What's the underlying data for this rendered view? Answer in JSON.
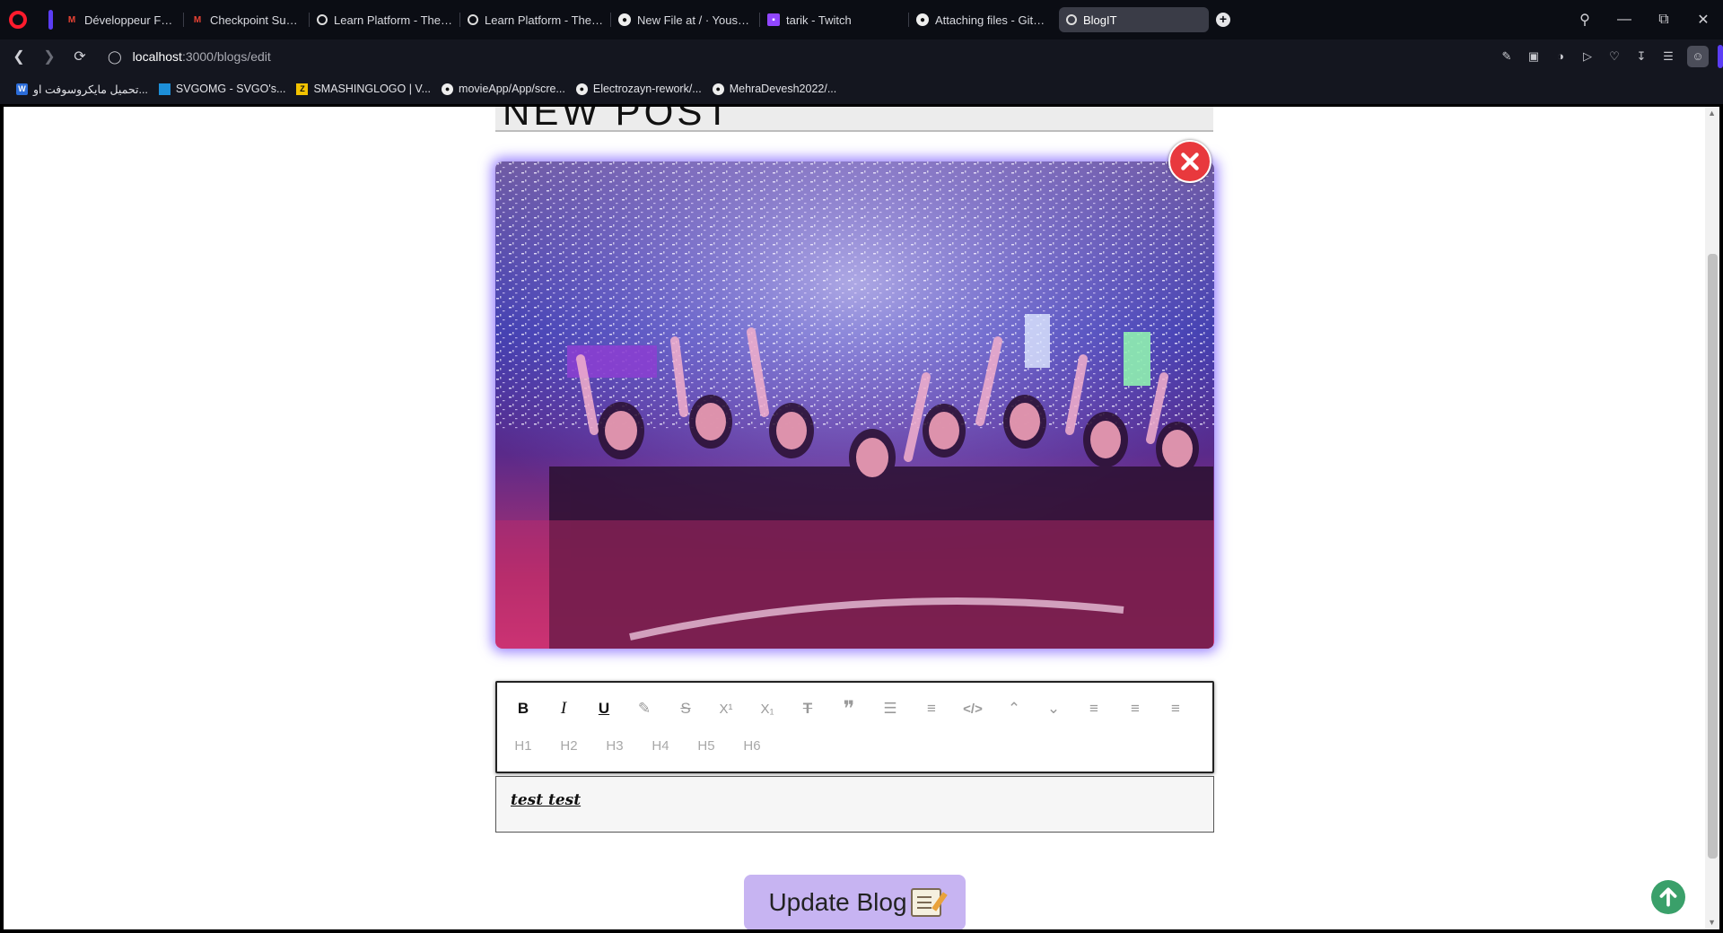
{
  "browser": {
    "tabs": [
      {
        "label": "Développeur Fullstack js -",
        "icon": "gmail-icon"
      },
      {
        "label": "Checkpoint Submitted - G",
        "icon": "gmail-icon"
      },
      {
        "label": "Learn Platform - The GOM",
        "icon": "globe-icon"
      },
      {
        "label": "Learn Platform - The GOM",
        "icon": "globe-icon"
      },
      {
        "label": "New File at / · YoussefRs/",
        "icon": "github-icon"
      },
      {
        "label": "tarik - Twitch",
        "icon": "twitch-icon"
      },
      {
        "label": "Attaching files - GitHub D",
        "icon": "github-icon"
      },
      {
        "label": "BlogIT",
        "icon": "globe-icon",
        "active": true
      }
    ],
    "url": {
      "host": "localhost",
      "path": ":3000/blogs/edit"
    },
    "bookmarks": [
      {
        "label": "تحميل مايكروسوفت او...",
        "icon": "office-icon"
      },
      {
        "label": "SVGOMG - SVGO's...",
        "icon": "svgomg-icon"
      },
      {
        "label": "SMASHINGLOGO | V...",
        "icon": "smashinglogo-icon"
      },
      {
        "label": "movieApp/App/scre...",
        "icon": "github-icon"
      },
      {
        "label": "Electrozayn-rework/...",
        "icon": "github-icon"
      },
      {
        "label": "MehraDevesh2022/...",
        "icon": "github-icon"
      }
    ]
  },
  "page": {
    "heading": "NEW POST",
    "editor": {
      "toolbar_row1": [
        {
          "label": "B",
          "icon": "bold-icon"
        },
        {
          "label": "I",
          "icon": "italic-icon"
        },
        {
          "label": "U",
          "icon": "underline-icon"
        },
        {
          "label": "",
          "icon": "highlight-icon"
        },
        {
          "label": "S",
          "icon": "strikethrough-icon"
        },
        {
          "label": "X¹",
          "icon": "superscript-icon"
        },
        {
          "label": "X₁",
          "icon": "subscript-icon"
        },
        {
          "label": "",
          "icon": "clear-format-icon"
        },
        {
          "label": "❞",
          "icon": "blockquote-icon"
        },
        {
          "label": "",
          "icon": "bullet-list-icon"
        },
        {
          "label": "",
          "icon": "ordered-list-icon"
        },
        {
          "label": "</>",
          "icon": "code-icon"
        },
        {
          "label": "",
          "icon": "chevron-up-icon"
        },
        {
          "label": "",
          "icon": "chevron-down-icon"
        },
        {
          "label": "",
          "icon": "align-left-icon"
        },
        {
          "label": "",
          "icon": "align-center-icon"
        },
        {
          "label": "",
          "icon": "align-right-icon"
        }
      ],
      "headings": [
        "H1",
        "H2",
        "H3",
        "H4",
        "H5",
        "H6"
      ],
      "content": "test test"
    },
    "update_button": "Update Blog"
  },
  "colors": {
    "accent": "#c7b4f2",
    "close": "#e8393d",
    "scroll_top": "#3aa06a",
    "image_glow": "#785aff"
  }
}
